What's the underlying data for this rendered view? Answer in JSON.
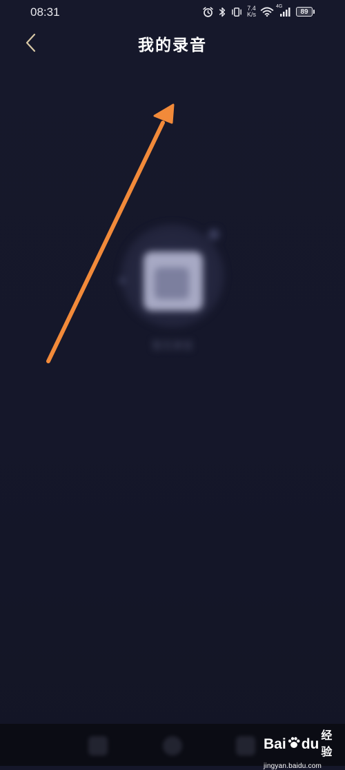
{
  "status_bar": {
    "time": "08:31",
    "network_speed_value": "7.4",
    "network_speed_unit": "K/s",
    "network_type": "4G",
    "battery_level": "89"
  },
  "header": {
    "title": "我的录音"
  },
  "empty_state": {
    "message": "暂无录音"
  },
  "watermark": {
    "logo_bai": "Bai",
    "logo_du": "du",
    "logo_jingyan": "经验",
    "url": "jingyan.baidu.com"
  },
  "colors": {
    "background": "#15172a",
    "annotation_arrow": "#f28a3a",
    "title": "#ffffff"
  },
  "icons": {
    "back": "chevron-left-icon",
    "alarm": "alarm-icon",
    "bluetooth": "bluetooth-icon",
    "vibrate": "vibrate-icon",
    "wifi": "wifi-icon",
    "signal": "signal-icon",
    "battery": "battery-icon"
  }
}
